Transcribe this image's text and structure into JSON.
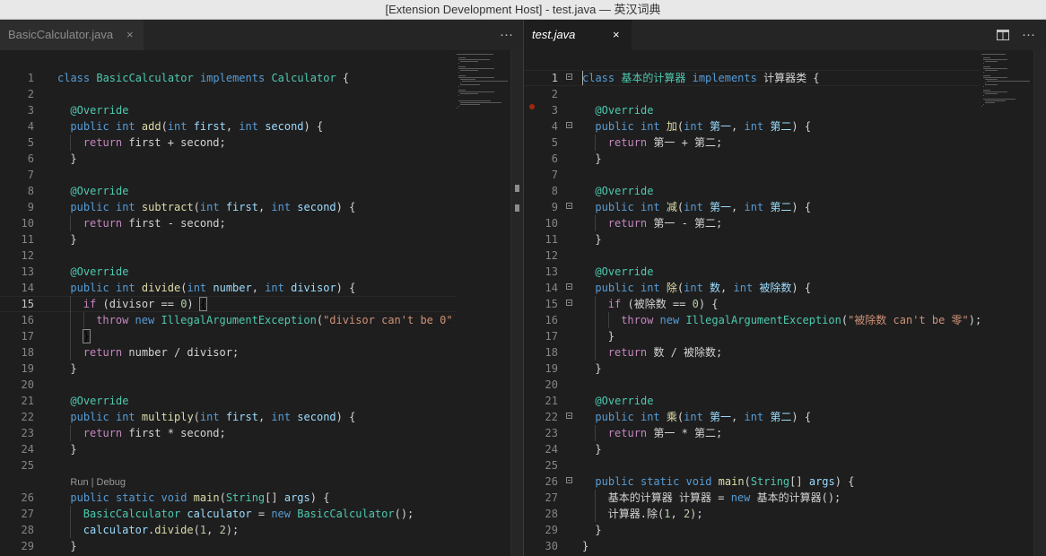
{
  "window": {
    "title": "[Extension Development Host] - test.java — 英汉词典"
  },
  "left": {
    "tab": {
      "label": "BasicCalculator.java",
      "close_glyph": "×"
    },
    "more_glyph": "···",
    "codelens": "Run | Debug",
    "active_line": "15",
    "lines": [
      {
        "n": "1",
        "indent": 0,
        "t": [
          [
            "kw",
            "class "
          ],
          [
            "cls",
            "BasicCalculator "
          ],
          [
            "kw",
            "implements "
          ],
          [
            "cls",
            "Calculator "
          ],
          [
            "txt",
            "{"
          ]
        ]
      },
      {
        "n": "2",
        "indent": 0,
        "t": []
      },
      {
        "n": "3",
        "indent": 1,
        "t": [
          [
            "ann",
            "@Override"
          ]
        ]
      },
      {
        "n": "4",
        "indent": 1,
        "t": [
          [
            "kw",
            "public "
          ],
          [
            "kw",
            "int "
          ],
          [
            "fn",
            "add"
          ],
          [
            "txt",
            "("
          ],
          [
            "kw",
            "int "
          ],
          [
            "var",
            "first"
          ],
          [
            "txt",
            ", "
          ],
          [
            "kw",
            "int "
          ],
          [
            "var",
            "second"
          ],
          [
            "txt",
            ") {"
          ]
        ]
      },
      {
        "n": "5",
        "indent": 2,
        "t": [
          [
            "ctl",
            "return "
          ],
          [
            "txt",
            "first + second;"
          ]
        ]
      },
      {
        "n": "6",
        "indent": 1,
        "t": [
          [
            "txt",
            "}"
          ]
        ]
      },
      {
        "n": "7",
        "indent": 0,
        "t": []
      },
      {
        "n": "8",
        "indent": 1,
        "t": [
          [
            "ann",
            "@Override"
          ]
        ]
      },
      {
        "n": "9",
        "indent": 1,
        "t": [
          [
            "kw",
            "public "
          ],
          [
            "kw",
            "int "
          ],
          [
            "fn",
            "subtract"
          ],
          [
            "txt",
            "("
          ],
          [
            "kw",
            "int "
          ],
          [
            "var",
            "first"
          ],
          [
            "txt",
            ", "
          ],
          [
            "kw",
            "int "
          ],
          [
            "var",
            "second"
          ],
          [
            "txt",
            ") {"
          ]
        ]
      },
      {
        "n": "10",
        "indent": 2,
        "t": [
          [
            "ctl",
            "return "
          ],
          [
            "txt",
            "first - second;"
          ]
        ]
      },
      {
        "n": "11",
        "indent": 1,
        "t": [
          [
            "txt",
            "}"
          ]
        ]
      },
      {
        "n": "12",
        "indent": 0,
        "t": []
      },
      {
        "n": "13",
        "indent": 1,
        "t": [
          [
            "ann",
            "@Override"
          ]
        ]
      },
      {
        "n": "14",
        "indent": 1,
        "t": [
          [
            "kw",
            "public "
          ],
          [
            "kw",
            "int "
          ],
          [
            "fn",
            "divide"
          ],
          [
            "txt",
            "("
          ],
          [
            "kw",
            "int "
          ],
          [
            "var",
            "number"
          ],
          [
            "txt",
            ", "
          ],
          [
            "kw",
            "int "
          ],
          [
            "var",
            "divisor"
          ],
          [
            "txt",
            ") {"
          ]
        ]
      },
      {
        "n": "15",
        "indent": 2,
        "t": [
          [
            "ctl",
            "if "
          ],
          [
            "txt",
            "(divisor == "
          ],
          [
            "num",
            "0"
          ],
          [
            "txt",
            ") "
          ],
          [
            "bm",
            "{"
          ]
        ]
      },
      {
        "n": "16",
        "indent": 3,
        "t": [
          [
            "ctl",
            "throw "
          ],
          [
            "kw",
            "new "
          ],
          [
            "cls",
            "IllegalArgumentException"
          ],
          [
            "txt",
            "("
          ],
          [
            "str",
            "\"divisor can't be 0\""
          ],
          [
            "txt",
            ");"
          ]
        ]
      },
      {
        "n": "17",
        "indent": 2,
        "t": [
          [
            "bm",
            "}"
          ]
        ]
      },
      {
        "n": "18",
        "indent": 2,
        "t": [
          [
            "ctl",
            "return "
          ],
          [
            "txt",
            "number / divisor;"
          ]
        ]
      },
      {
        "n": "19",
        "indent": 1,
        "t": [
          [
            "txt",
            "}"
          ]
        ]
      },
      {
        "n": "20",
        "indent": 0,
        "t": []
      },
      {
        "n": "21",
        "indent": 1,
        "t": [
          [
            "ann",
            "@Override"
          ]
        ]
      },
      {
        "n": "22",
        "indent": 1,
        "t": [
          [
            "kw",
            "public "
          ],
          [
            "kw",
            "int "
          ],
          [
            "fn",
            "multiply"
          ],
          [
            "txt",
            "("
          ],
          [
            "kw",
            "int "
          ],
          [
            "var",
            "first"
          ],
          [
            "txt",
            ", "
          ],
          [
            "kw",
            "int "
          ],
          [
            "var",
            "second"
          ],
          [
            "txt",
            ") {"
          ]
        ]
      },
      {
        "n": "23",
        "indent": 2,
        "t": [
          [
            "ctl",
            "return "
          ],
          [
            "txt",
            "first * second;"
          ]
        ]
      },
      {
        "n": "24",
        "indent": 1,
        "t": [
          [
            "txt",
            "}"
          ]
        ]
      },
      {
        "n": "25",
        "indent": 0,
        "t": []
      },
      {
        "n": "",
        "indent": 1,
        "codelens": true,
        "t": []
      },
      {
        "n": "26",
        "indent": 1,
        "t": [
          [
            "kw",
            "public "
          ],
          [
            "kw",
            "static "
          ],
          [
            "kw",
            "void "
          ],
          [
            "fn",
            "main"
          ],
          [
            "txt",
            "("
          ],
          [
            "cls",
            "String"
          ],
          [
            "txt",
            "[] "
          ],
          [
            "var",
            "args"
          ],
          [
            "txt",
            ") {"
          ]
        ]
      },
      {
        "n": "27",
        "indent": 2,
        "t": [
          [
            "cls",
            "BasicCalculator "
          ],
          [
            "var",
            "calculator "
          ],
          [
            "txt",
            "= "
          ],
          [
            "kw",
            "new "
          ],
          [
            "cls",
            "BasicCalculator"
          ],
          [
            "txt",
            "();"
          ]
        ]
      },
      {
        "n": "28",
        "indent": 2,
        "t": [
          [
            "var",
            "calculator"
          ],
          [
            "txt",
            "."
          ],
          [
            "fn",
            "divide"
          ],
          [
            "txt",
            "("
          ],
          [
            "num",
            "1"
          ],
          [
            "txt",
            ", "
          ],
          [
            "num",
            "2"
          ],
          [
            "txt",
            ");"
          ]
        ]
      },
      {
        "n": "29",
        "indent": 1,
        "t": [
          [
            "txt",
            "}"
          ]
        ]
      },
      {
        "n": "30",
        "indent": 0,
        "t": [
          [
            "txt",
            "}"
          ]
        ]
      }
    ]
  },
  "right": {
    "tab": {
      "label": "test.java",
      "close_glyph": "×"
    },
    "split_icon": "split-editor-icon",
    "more_glyph": "···",
    "active_line": "1",
    "lines": [
      {
        "n": "1",
        "indent": 0,
        "fold": true,
        "t": [
          [
            "kw",
            "class "
          ],
          [
            "cls",
            "基本的计算器 "
          ],
          [
            "kw",
            "implements "
          ],
          [
            "txt",
            "计算器类 {"
          ]
        ]
      },
      {
        "n": "2",
        "indent": 0,
        "t": []
      },
      {
        "n": "3",
        "indent": 1,
        "t": [
          [
            "ann",
            "@Override"
          ]
        ]
      },
      {
        "n": "4",
        "indent": 1,
        "fold": true,
        "t": [
          [
            "kw",
            "public "
          ],
          [
            "kw",
            "int "
          ],
          [
            "fn",
            "加"
          ],
          [
            "txt",
            "("
          ],
          [
            "kw",
            "int "
          ],
          [
            "var",
            "第一"
          ],
          [
            "txt",
            ", "
          ],
          [
            "kw",
            "int "
          ],
          [
            "var",
            "第二"
          ],
          [
            "txt",
            ") {"
          ]
        ]
      },
      {
        "n": "5",
        "indent": 2,
        "t": [
          [
            "ctl",
            "return "
          ],
          [
            "txt",
            "第一 + 第二;"
          ]
        ]
      },
      {
        "n": "6",
        "indent": 1,
        "t": [
          [
            "txt",
            "}"
          ]
        ]
      },
      {
        "n": "7",
        "indent": 0,
        "t": []
      },
      {
        "n": "8",
        "indent": 1,
        "t": [
          [
            "ann",
            "@Override"
          ]
        ]
      },
      {
        "n": "9",
        "indent": 1,
        "fold": true,
        "t": [
          [
            "kw",
            "public "
          ],
          [
            "kw",
            "int "
          ],
          [
            "fn",
            "减"
          ],
          [
            "txt",
            "("
          ],
          [
            "kw",
            "int "
          ],
          [
            "var",
            "第一"
          ],
          [
            "txt",
            ", "
          ],
          [
            "kw",
            "int "
          ],
          [
            "var",
            "第二"
          ],
          [
            "txt",
            ") {"
          ]
        ]
      },
      {
        "n": "10",
        "indent": 2,
        "t": [
          [
            "ctl",
            "return "
          ],
          [
            "txt",
            "第一 - 第二;"
          ]
        ]
      },
      {
        "n": "11",
        "indent": 1,
        "t": [
          [
            "txt",
            "}"
          ]
        ]
      },
      {
        "n": "12",
        "indent": 0,
        "t": []
      },
      {
        "n": "13",
        "indent": 1,
        "t": [
          [
            "ann",
            "@Override"
          ]
        ]
      },
      {
        "n": "14",
        "indent": 1,
        "fold": true,
        "t": [
          [
            "kw",
            "public "
          ],
          [
            "kw",
            "int "
          ],
          [
            "fn",
            "除"
          ],
          [
            "txt",
            "("
          ],
          [
            "kw",
            "int "
          ],
          [
            "var",
            "数"
          ],
          [
            "txt",
            ", "
          ],
          [
            "kw",
            "int "
          ],
          [
            "var",
            "被除数"
          ],
          [
            "txt",
            ") {"
          ]
        ]
      },
      {
        "n": "15",
        "indent": 2,
        "fold": true,
        "t": [
          [
            "ctl",
            "if "
          ],
          [
            "txt",
            "(被除数 == "
          ],
          [
            "num",
            "0"
          ],
          [
            "txt",
            ") {"
          ]
        ]
      },
      {
        "n": "16",
        "indent": 3,
        "t": [
          [
            "ctl",
            "throw "
          ],
          [
            "kw",
            "new "
          ],
          [
            "cls",
            "IllegalArgumentException"
          ],
          [
            "txt",
            "("
          ],
          [
            "str",
            "\"被除数 can't be 零\""
          ],
          [
            "txt",
            ");"
          ]
        ]
      },
      {
        "n": "17",
        "indent": 2,
        "t": [
          [
            "txt",
            "}"
          ]
        ]
      },
      {
        "n": "18",
        "indent": 2,
        "t": [
          [
            "ctl",
            "return "
          ],
          [
            "txt",
            "数 / 被除数;"
          ]
        ]
      },
      {
        "n": "19",
        "indent": 1,
        "t": [
          [
            "txt",
            "}"
          ]
        ]
      },
      {
        "n": "20",
        "indent": 0,
        "t": []
      },
      {
        "n": "21",
        "indent": 1,
        "t": [
          [
            "ann",
            "@Override"
          ]
        ]
      },
      {
        "n": "22",
        "indent": 1,
        "fold": true,
        "t": [
          [
            "kw",
            "public "
          ],
          [
            "kw",
            "int "
          ],
          [
            "fn",
            "乘"
          ],
          [
            "txt",
            "("
          ],
          [
            "kw",
            "int "
          ],
          [
            "var",
            "第一"
          ],
          [
            "txt",
            ", "
          ],
          [
            "kw",
            "int "
          ],
          [
            "var",
            "第二"
          ],
          [
            "txt",
            ") {"
          ]
        ]
      },
      {
        "n": "23",
        "indent": 2,
        "t": [
          [
            "ctl",
            "return "
          ],
          [
            "txt",
            "第一 * 第二;"
          ]
        ]
      },
      {
        "n": "24",
        "indent": 1,
        "t": [
          [
            "txt",
            "}"
          ]
        ]
      },
      {
        "n": "25",
        "indent": 0,
        "t": []
      },
      {
        "n": "26",
        "indent": 1,
        "fold": true,
        "t": [
          [
            "kw",
            "public "
          ],
          [
            "kw",
            "static "
          ],
          [
            "kw",
            "void "
          ],
          [
            "fn",
            "main"
          ],
          [
            "txt",
            "("
          ],
          [
            "cls",
            "String"
          ],
          [
            "txt",
            "[] "
          ],
          [
            "var",
            "args"
          ],
          [
            "txt",
            ") {"
          ]
        ]
      },
      {
        "n": "27",
        "indent": 2,
        "t": [
          [
            "txt",
            "基本的计算器 计算器 = "
          ],
          [
            "kw",
            "new "
          ],
          [
            "txt",
            "基本的计算器();"
          ]
        ]
      },
      {
        "n": "28",
        "indent": 2,
        "t": [
          [
            "txt",
            "计算器.除("
          ],
          [
            "num",
            "1"
          ],
          [
            "txt",
            ", "
          ],
          [
            "num",
            "2"
          ],
          [
            "txt",
            ");"
          ]
        ]
      },
      {
        "n": "29",
        "indent": 1,
        "t": [
          [
            "txt",
            "}"
          ]
        ]
      },
      {
        "n": "30",
        "indent": 0,
        "t": [
          [
            "txt",
            "}"
          ]
        ]
      }
    ]
  }
}
